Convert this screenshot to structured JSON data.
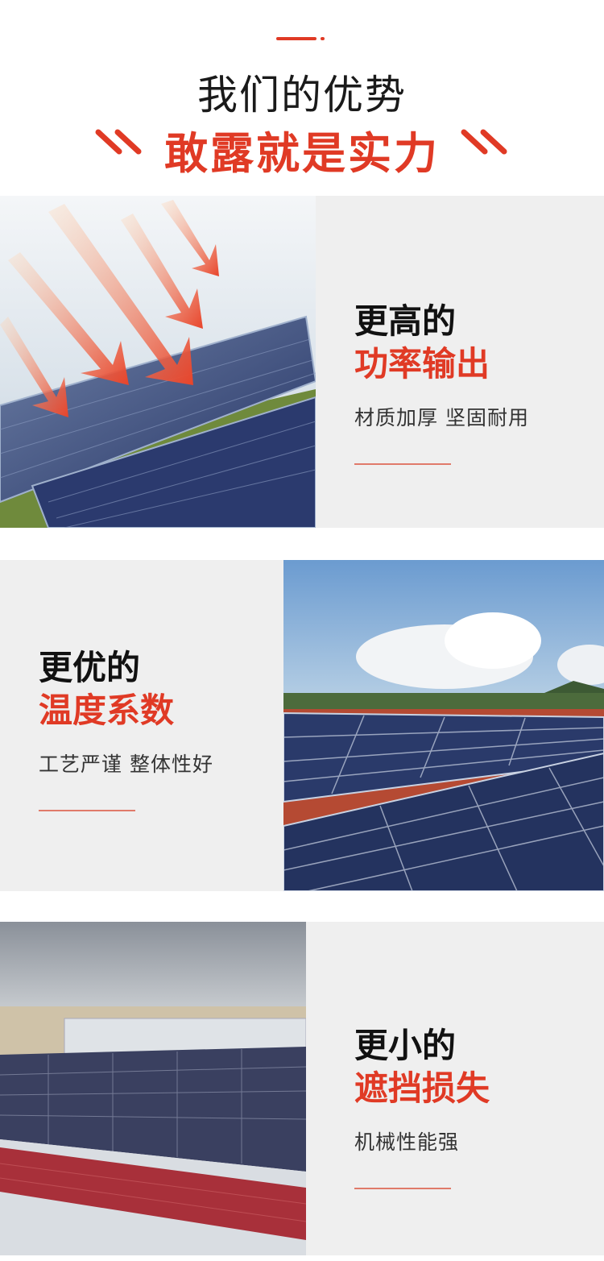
{
  "header": {
    "title": "我们的优势",
    "subtitle": "敢露就是实力",
    "accent_color": "#e03a25"
  },
  "features": [
    {
      "heading_line1": "更高的",
      "heading_line2": "功率输出",
      "description": "材质加厚 坚固耐用",
      "photo": "solar-panels-sun-arrows"
    },
    {
      "heading_line1": "更优的",
      "heading_line2": "温度系数",
      "description": "工艺严谨 整体性好",
      "photo": "rooftop-solar-array-sky"
    },
    {
      "heading_line1": "更小的",
      "heading_line2": "遮挡损失",
      "description": "机械性能强",
      "photo": "industrial-roof-solar-panels"
    }
  ]
}
